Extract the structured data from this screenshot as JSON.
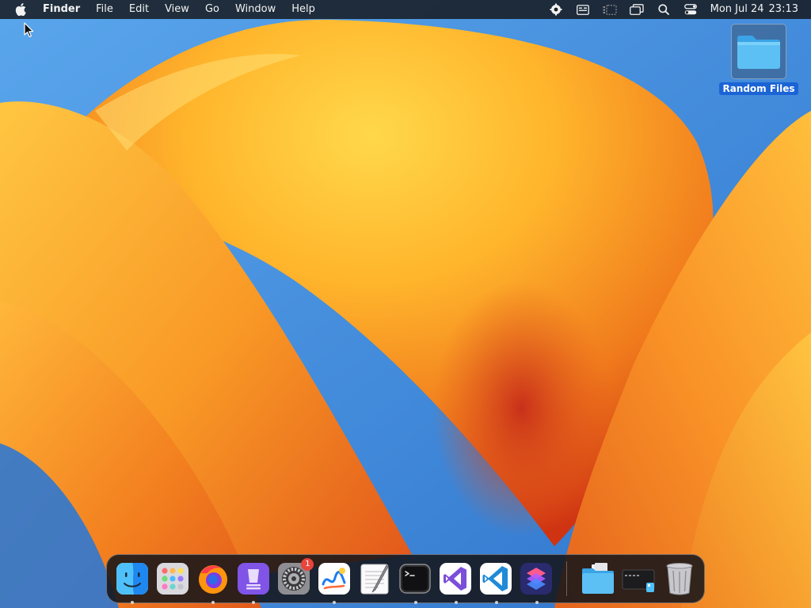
{
  "menubar": {
    "app_name": "Finder",
    "menus": [
      "File",
      "Edit",
      "View",
      "Go",
      "Window",
      "Help"
    ],
    "status_icons": [
      "screen-recorder-icon",
      "keyboard-input-icon",
      "stage-manager-icon",
      "display-mirroring-icon",
      "spotlight-search-icon",
      "control-center-icon"
    ],
    "clock": {
      "date": "Mon Jul 24",
      "time": "23:13"
    }
  },
  "desktop": {
    "items": [
      {
        "label": "Random Files",
        "icon": "folder-icon",
        "selected": true
      }
    ]
  },
  "dock": {
    "apps": [
      {
        "icon": "finder-icon",
        "running": true
      },
      {
        "icon": "launchpad-icon",
        "running": false
      },
      {
        "icon": "firefox-icon",
        "running": true
      },
      {
        "icon": "apple-configurator-icon",
        "running": true
      },
      {
        "icon": "system-settings-icon",
        "running": false,
        "badge": "1"
      },
      {
        "icon": "freeform-icon",
        "running": true
      },
      {
        "icon": "textedit-icon",
        "running": false
      },
      {
        "icon": "terminal-icon",
        "running": true
      },
      {
        "icon": "visual-studio-icon",
        "running": true
      },
      {
        "icon": "vscode-icon",
        "running": true
      },
      {
        "icon": "shortcuts-icon",
        "running": true
      }
    ],
    "stacks": [
      {
        "icon": "downloads-folder-icon"
      },
      {
        "icon": "screenshots-stack-icon"
      },
      {
        "icon": "trash-icon"
      }
    ]
  },
  "colors": {
    "sky_blue": "#3f86d6",
    "petal_yellow": "#ffc53a",
    "petal_orange": "#f5861f",
    "petal_deep": "#d83d16",
    "selection_blue": "#1b64d6",
    "badge_red": "#e8453c"
  }
}
